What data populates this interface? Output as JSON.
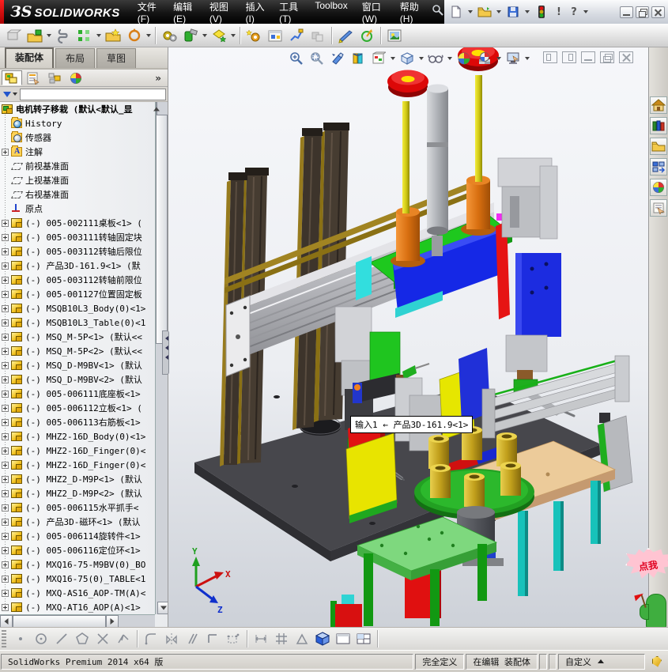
{
  "titlebar": {
    "logo": "ЗS",
    "brand": "SOLIDWORKS",
    "menus": [
      "文件(F)",
      "编辑(E)",
      "视图(V)",
      "插入(I)",
      "工具(T)",
      "Toolbox",
      "窗口(W)",
      "帮助(H)"
    ],
    "help_glyph": "?",
    "alert_glyph": "!"
  },
  "tabs": [
    {
      "t": "装配体",
      "c": "active"
    },
    {
      "t": "布局",
      "c": ""
    },
    {
      "t": "草图",
      "c": ""
    }
  ],
  "panel": {
    "chevron": "»",
    "root_label": "电机转子移栽 (默认<默认_显",
    "tree": [
      {
        "c": "hist",
        "t": "History"
      },
      {
        "c": "sensor",
        "t": "传感器"
      },
      {
        "c": "anno e",
        "t": "注解"
      },
      {
        "c": "plane",
        "t": "前视基准面"
      },
      {
        "c": "plane",
        "t": "上视基准面"
      },
      {
        "c": "plane",
        "t": "右视基准面"
      },
      {
        "c": "origin",
        "t": "原点"
      },
      {
        "c": "part e",
        "t": "(-) 005-002111桌板<1> ("
      },
      {
        "c": "part e",
        "t": "(-) 005-003111转轴固定块"
      },
      {
        "c": "part e",
        "t": "(-) 005-003112转轴后限位"
      },
      {
        "c": "part e",
        "t": "(-) 产品3D-161.9<1> (默"
      },
      {
        "c": "part e",
        "t": "(-) 005-003112转轴前限位"
      },
      {
        "c": "part e",
        "t": "(-) 005-001127位置固定板"
      },
      {
        "c": "part e",
        "t": "(-) MSQB10L3_Body(0)<1>"
      },
      {
        "c": "part e",
        "t": "(-) MSQB10L3_Table(0)<1"
      },
      {
        "c": "part e",
        "t": "(-) MSQ_M-5P<1> (默认<<"
      },
      {
        "c": "part e",
        "t": "(-) MSQ_M-5P<2> (默认<<"
      },
      {
        "c": "part e",
        "t": "(-) MSQ_D-M9BV<1> (默认"
      },
      {
        "c": "part e",
        "t": "(-) MSQ_D-M9BV<2> (默认"
      },
      {
        "c": "part e",
        "t": "(-) 005-006111底座板<1>"
      },
      {
        "c": "part e",
        "t": "(-) 005-006112立板<1> ("
      },
      {
        "c": "part e",
        "t": "(-) 005-006113右筋板<1>"
      },
      {
        "c": "part e",
        "t": "(-) MHZ2-16D_Body(0)<1>"
      },
      {
        "c": "part e",
        "t": "(-) MHZ2-16D_Finger(0)<"
      },
      {
        "c": "part e",
        "t": "(-) MHZ2-16D_Finger(0)<"
      },
      {
        "c": "part e",
        "t": "(-) MHZ2_D-M9P<1> (默认"
      },
      {
        "c": "part e",
        "t": "(-) MHZ2_D-M9P<2> (默认"
      },
      {
        "c": "part e",
        "t": "(-) 005-006115水平抓手<"
      },
      {
        "c": "part e",
        "t": "(-) 产品3D-磁环<1> (默认"
      },
      {
        "c": "part e",
        "t": "(-) 005-006114旋转件<1>"
      },
      {
        "c": "part e",
        "t": "(-) 005-006116定位环<1>"
      },
      {
        "c": "part e",
        "t": "(-) MXQ16-75-M9BV(0)_BO"
      },
      {
        "c": "part e",
        "t": "(-) MXQ16-75(0)_TABLE<1"
      },
      {
        "c": "part e",
        "t": "(-) MXQ-AS16_AOP-TM(A)<"
      },
      {
        "c": "part e",
        "t": "(-) MXQ-AT16_AOP(A)<1>"
      }
    ]
  },
  "viewport": {
    "tooltip": "输入1 ← 产品3D-161.9<1>",
    "triad": {
      "x": "X",
      "y": "Y",
      "z": "Z"
    },
    "mascot": "点我"
  },
  "statusbar": {
    "product": "SolidWorks Premium 2014 x64 版",
    "define_state": "完全定义",
    "edit_state": "在编辑 装配体",
    "custom": "自定义"
  }
}
